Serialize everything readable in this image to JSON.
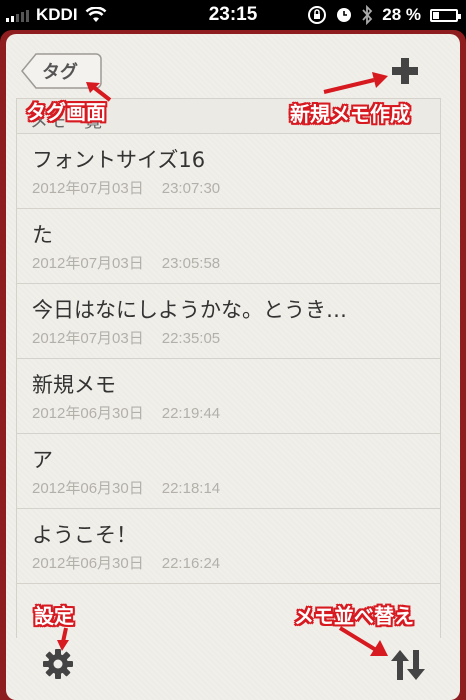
{
  "statusbar": {
    "carrier": "KDDI",
    "time": "23:15",
    "battery": "28 %",
    "battery_level": 0.28
  },
  "nav": {
    "back_label": "タグ"
  },
  "list": {
    "header": "メモ一覧",
    "items": [
      {
        "title": "フォントサイズ16",
        "date": "2012年07月03日",
        "time": "23:07:30"
      },
      {
        "title": "た",
        "date": "2012年07月03日",
        "time": "23:05:58"
      },
      {
        "title": "今日はなにしようかな。とうき…",
        "date": "2012年07月03日",
        "time": "22:35:05"
      },
      {
        "title": "新規メモ",
        "date": "2012年06月30日",
        "time": "22:19:44"
      },
      {
        "title": "ア",
        "date": "2012年06月30日",
        "time": "22:18:14"
      },
      {
        "title": "ようこそ！",
        "date": "2012年06月30日",
        "time": "22:16:24"
      }
    ]
  },
  "annotations": {
    "tag_screen": "タグ画面",
    "new_memo": "新規メモ作成",
    "settings": "設定",
    "sort": "メモ並べ替え",
    "color": "#d71920"
  },
  "icons": {
    "back": "chevron-left-icon",
    "add": "plus-icon",
    "settings": "gear-icon",
    "sort": "up-down-arrows-icon"
  }
}
